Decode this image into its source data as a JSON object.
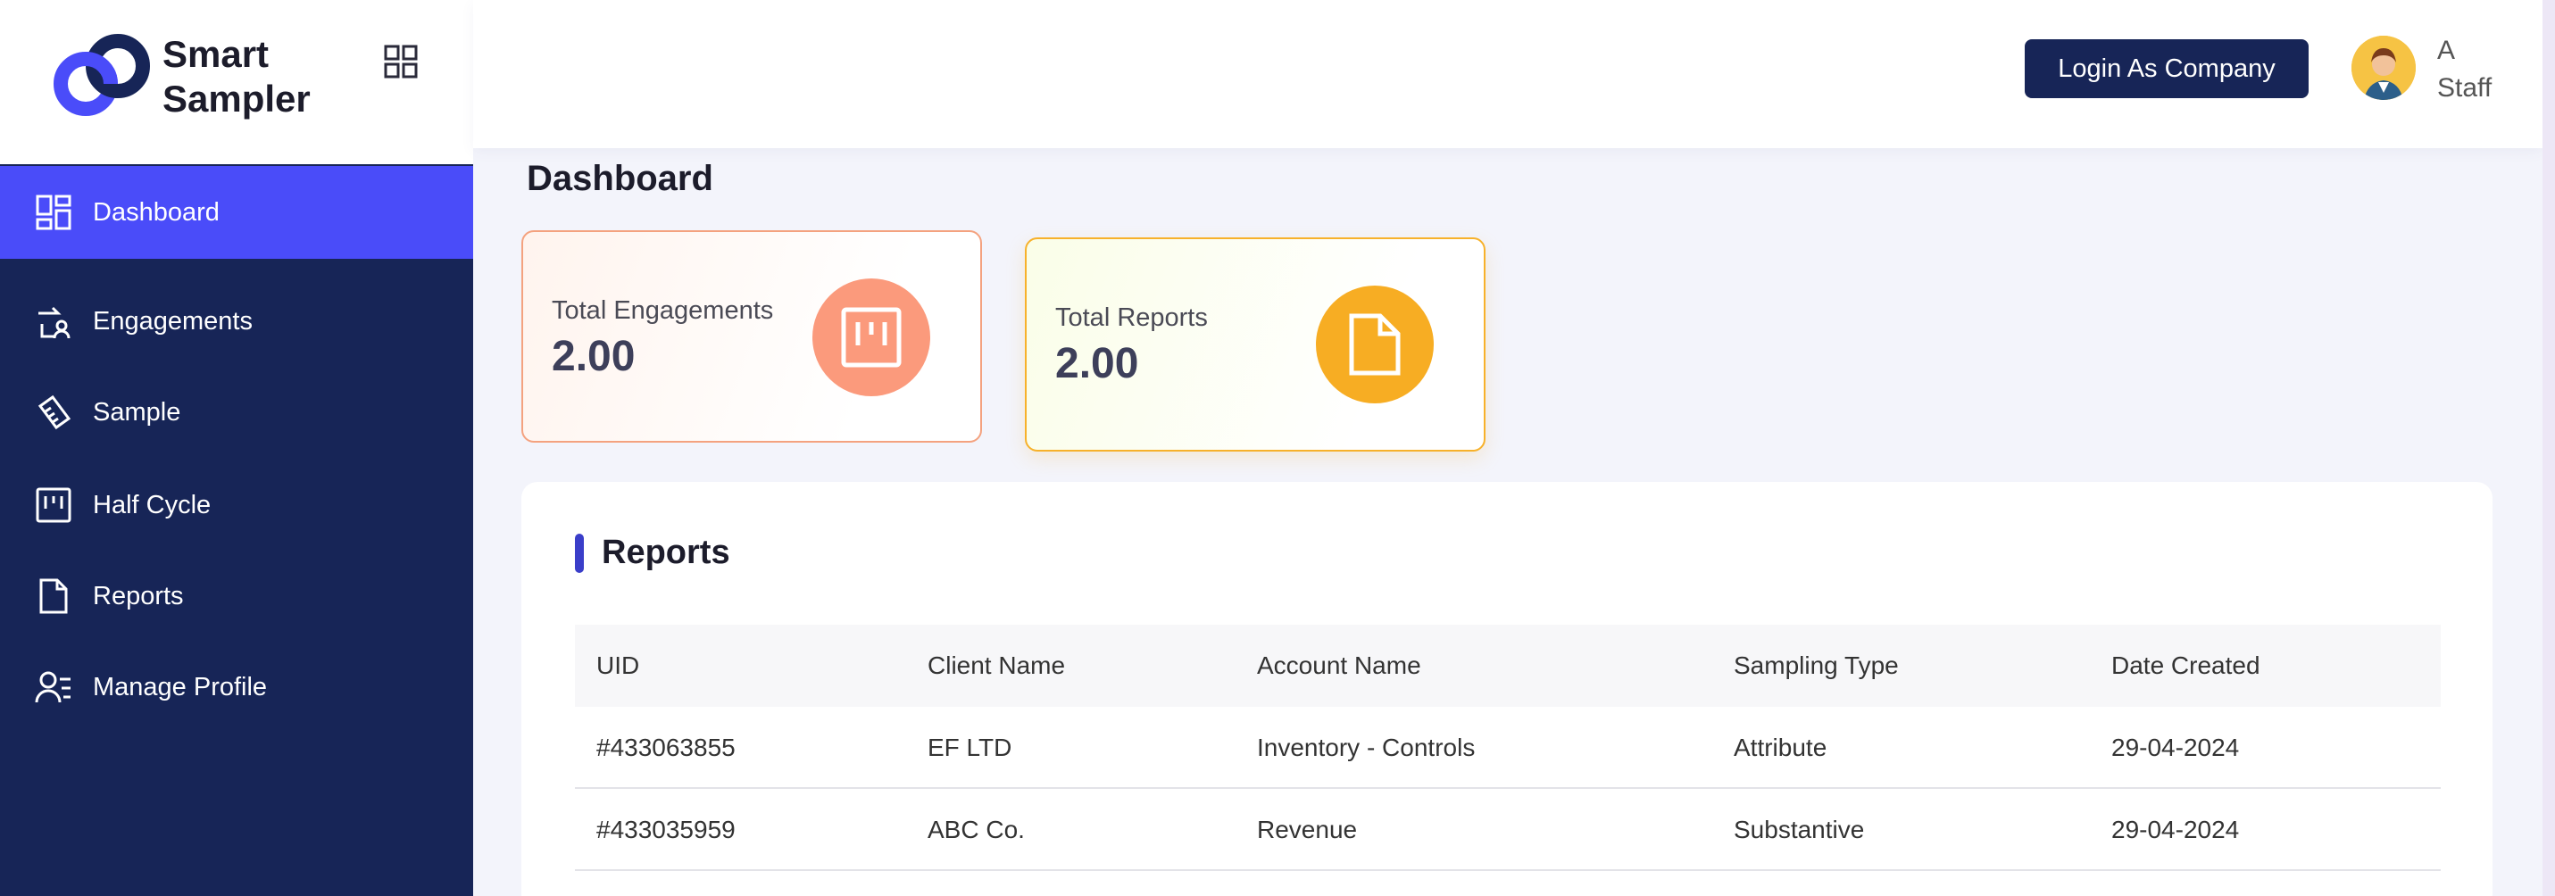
{
  "brand": {
    "name_line1": "Smart",
    "name_line2": "Sampler"
  },
  "sidebar": {
    "items": [
      {
        "label": "Dashboard",
        "icon": "dashboard-icon",
        "active": true
      },
      {
        "label": "Engagements",
        "icon": "engagements-icon"
      },
      {
        "label": "Sample",
        "icon": "sample-icon"
      },
      {
        "label": "Half Cycle",
        "icon": "half-cycle-icon"
      },
      {
        "label": "Reports",
        "icon": "document-icon"
      },
      {
        "label": "Manage Profile",
        "icon": "manage-profile-icon"
      }
    ]
  },
  "header": {
    "login_button": "Login As Company",
    "user": {
      "line1": "A",
      "line2": "Staff"
    }
  },
  "page": {
    "title": "Dashboard"
  },
  "stats": [
    {
      "label": "Total Engagements",
      "value": "2.00",
      "color": "#fb9a7c"
    },
    {
      "label": "Total Reports",
      "value": "2.00",
      "color": "#f7ad23"
    }
  ],
  "reports": {
    "title": "Reports",
    "columns": [
      "UID",
      "Client Name",
      "Account Name",
      "Sampling Type",
      "Date Created"
    ],
    "rows": [
      [
        "#433063855",
        "EF LTD",
        "Inventory - Controls",
        "Attribute",
        "29-04-2024"
      ],
      [
        "#433035959",
        "ABC Co.",
        "Revenue",
        "Substantive",
        "29-04-2024"
      ]
    ]
  },
  "colors": {
    "sidebar": "#172557",
    "active": "#4a4cf9",
    "button": "#172557"
  }
}
